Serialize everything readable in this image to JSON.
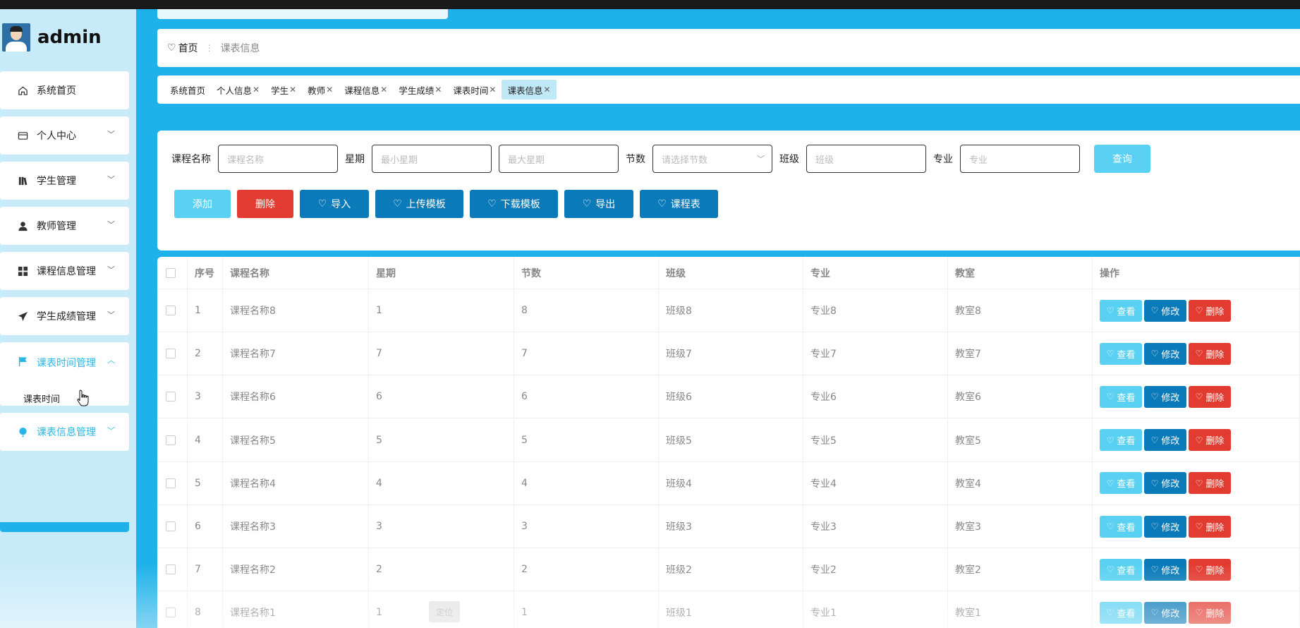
{
  "app": {
    "username": "admin"
  },
  "sidebar": {
    "items": [
      {
        "label": "系统首页",
        "icon": "home-icon"
      },
      {
        "label": "个人中心",
        "icon": "card-icon"
      },
      {
        "label": "学生管理",
        "icon": "book-icon"
      },
      {
        "label": "教师管理",
        "icon": "user-icon"
      },
      {
        "label": "课程信息管理",
        "icon": "grid-icon"
      },
      {
        "label": "学生成绩管理",
        "icon": "send-icon"
      },
      {
        "label": "课表时间管理",
        "icon": "flag-icon",
        "sub": "课表时间"
      },
      {
        "label": "课表信息管理",
        "icon": "balloon-icon"
      }
    ]
  },
  "breadcrumb": {
    "home": "首页",
    "current": "课表信息"
  },
  "tags": [
    "系统首页",
    "个人信息",
    "学生",
    "教师",
    "课程信息",
    "学生成绩",
    "课表时间",
    "课表信息"
  ],
  "filters": {
    "course_label": "课程名称",
    "course_placeholder": "课程名称",
    "week_label": "星期",
    "week_min_placeholder": "最小星期",
    "week_max_placeholder": "最大星期",
    "section_label": "节数",
    "section_placeholder": "请选择节数",
    "class_label": "班级",
    "class_placeholder": "班级",
    "major_label": "专业",
    "major_placeholder": "专业",
    "query": "查询"
  },
  "actions": {
    "add": "添加",
    "delete": "删除",
    "import": "导入",
    "upload_template": "上传模板",
    "download_template": "下载模板",
    "export": "导出",
    "schedule": "课程表"
  },
  "table": {
    "headers": [
      "序号",
      "课程名称",
      "星期",
      "节数",
      "班级",
      "专业",
      "教室",
      "操作"
    ],
    "rows": [
      [
        "1",
        "课程名称8",
        "1",
        "8",
        "班级8",
        "专业8",
        "教室8"
      ],
      [
        "2",
        "课程名称7",
        "7",
        "7",
        "班级7",
        "专业7",
        "教室7"
      ],
      [
        "3",
        "课程名称6",
        "6",
        "6",
        "班级6",
        "专业6",
        "教室6"
      ],
      [
        "4",
        "课程名称5",
        "5",
        "5",
        "班级5",
        "专业5",
        "教室5"
      ],
      [
        "5",
        "课程名称4",
        "4",
        "4",
        "班级4",
        "专业4",
        "教室4"
      ],
      [
        "6",
        "课程名称3",
        "3",
        "3",
        "班级3",
        "专业3",
        "教室3"
      ],
      [
        "7",
        "课程名称2",
        "2",
        "2",
        "班级2",
        "专业2",
        "教室2"
      ],
      [
        "8",
        "课程名称1",
        "1",
        "1",
        "班级1",
        "专业1",
        "教室1"
      ]
    ],
    "op_view": "查看",
    "op_edit": "修改",
    "op_delete": "删除"
  },
  "floating": {
    "locate": "定位"
  },
  "colors": {
    "primary": "#1fb2ea",
    "light": "#5ad1f2",
    "dark": "#0a7ab8",
    "danger": "#e23c31"
  }
}
